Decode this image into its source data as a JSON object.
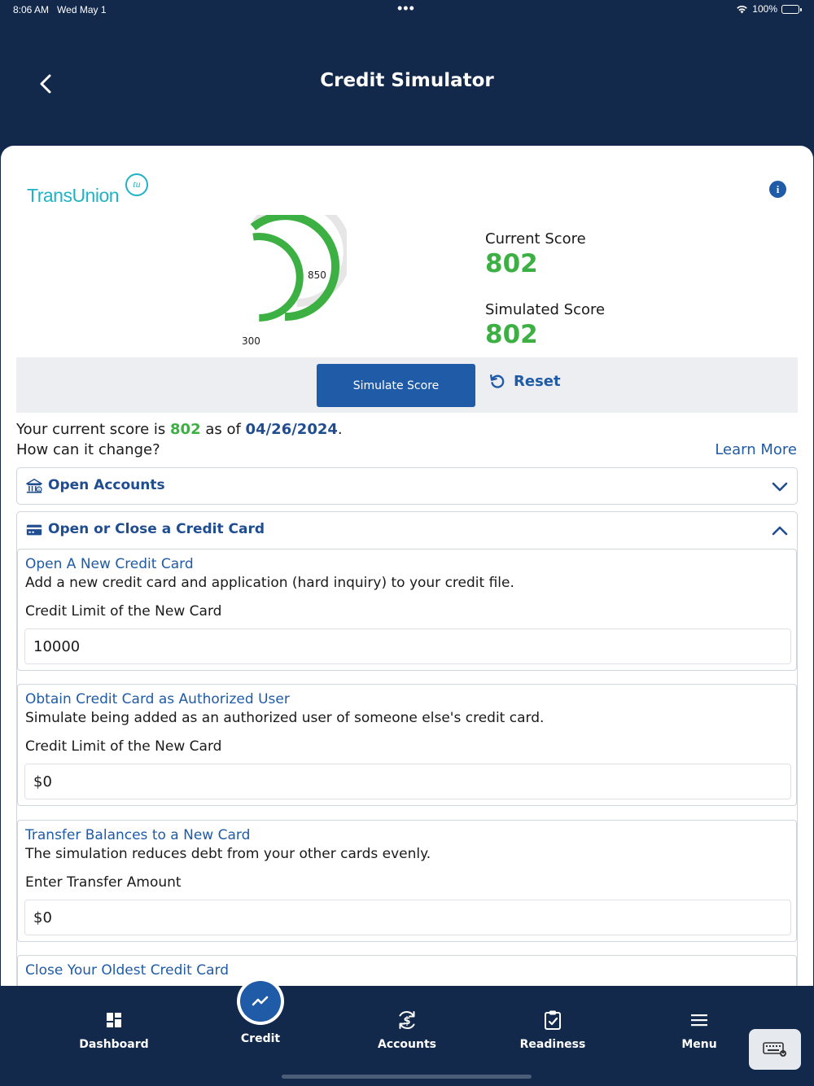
{
  "status_bar": {
    "time": "8:06 AM",
    "date": "Wed May 1",
    "battery": "100%"
  },
  "header": {
    "title": "Credit Simulator"
  },
  "brand": {
    "name": "TransUnion",
    "badge": "tu",
    "color": "#1fb3c5"
  },
  "gauge": {
    "min": "300",
    "max": "850",
    "current": 802,
    "min_value": 300,
    "max_value": 850
  },
  "scores": {
    "current_label": "Current Score",
    "current_value": "802",
    "simulated_label": "Simulated Score",
    "simulated_value": "802"
  },
  "actions": {
    "simulate_label": "Simulate Score",
    "reset_label": "Reset"
  },
  "summary": {
    "prefix": "Your current score is",
    "score": "802",
    "middle": "as of",
    "date": "04/26/2024",
    "suffix": ".",
    "question": "How can it change?",
    "learn_more": "Learn More"
  },
  "sections": [
    {
      "title": "Open Accounts",
      "expanded": false
    },
    {
      "title": "Open or Close a Credit Card",
      "expanded": true
    }
  ],
  "credit_card_options": [
    {
      "title": "Open A New Credit Card",
      "desc": "Add a new credit card and application (hard inquiry) to your credit file.",
      "label": "Credit Limit of the New Card",
      "value": "10000"
    },
    {
      "title": "Obtain Credit Card as Authorized User",
      "desc": "Simulate being added as an authorized user of someone else's credit card.",
      "label": "Credit Limit of the New Card",
      "value": "$0"
    },
    {
      "title": "Transfer Balances to a New Card",
      "desc": "The simulation reduces debt from your other cards evenly.",
      "label": "Enter Transfer Amount",
      "value": "$0"
    },
    {
      "title": "Close Your Oldest Credit Card"
    }
  ],
  "tabs": [
    {
      "label": "Dashboard",
      "icon": "dashboard-icon"
    },
    {
      "label": "Credit",
      "icon": "trend-icon",
      "active": true
    },
    {
      "label": "Accounts",
      "icon": "dollar-sync-icon"
    },
    {
      "label": "Readiness",
      "icon": "clipboard-check-icon"
    },
    {
      "label": "Menu",
      "icon": "hamburger-icon"
    }
  ],
  "colors": {
    "navy": "#13294b",
    "primary": "#1f5ba7",
    "score_green": "#3cb043",
    "brand_teal": "#1fb3c5"
  }
}
